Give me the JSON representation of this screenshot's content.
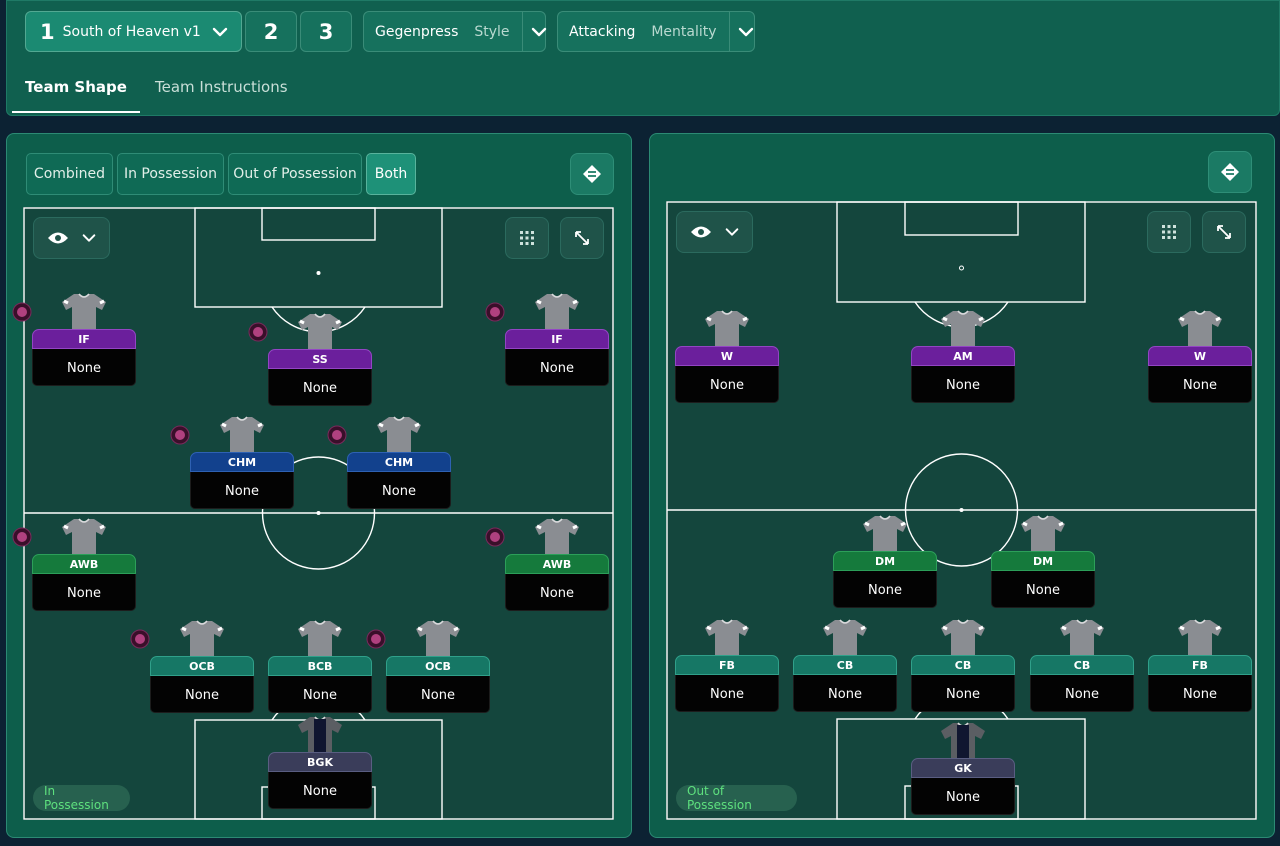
{
  "header": {
    "tactic_slots": [
      {
        "num": "1",
        "name": "South of Heaven v1"
      },
      {
        "num": "2"
      },
      {
        "num": "3"
      }
    ],
    "style": {
      "value": "Gegenpress",
      "label": "Style"
    },
    "mentality": {
      "value": "Attacking",
      "label": "Mentality"
    },
    "tabs": [
      "Team Shape",
      "Team Instructions"
    ]
  },
  "left_panel": {
    "view_tabs": [
      "Combined",
      "In Possession",
      "Out of Possession",
      "Both"
    ],
    "selected_view": "Both",
    "phase_label": "In Possession",
    "players": [
      {
        "role": "IF",
        "duty": "None",
        "color": "purple",
        "marked": true
      },
      {
        "role": "SS",
        "duty": "None",
        "color": "purple",
        "marked": true
      },
      {
        "role": "IF",
        "duty": "None",
        "color": "purple",
        "marked": true
      },
      {
        "role": "CHM",
        "duty": "None",
        "color": "blue",
        "marked": true
      },
      {
        "role": "CHM",
        "duty": "None",
        "color": "blue",
        "marked": true
      },
      {
        "role": "AWB",
        "duty": "None",
        "color": "green",
        "marked": true
      },
      {
        "role": "AWB",
        "duty": "None",
        "color": "green",
        "marked": true
      },
      {
        "role": "OCB",
        "duty": "None",
        "color": "teal",
        "marked": true
      },
      {
        "role": "BCB",
        "duty": "None",
        "color": "teal",
        "marked": false
      },
      {
        "role": "OCB",
        "duty": "None",
        "color": "teal",
        "marked": true
      },
      {
        "role": "BGK",
        "duty": "None",
        "color": "slate",
        "marked": false,
        "goalkeeper": true
      }
    ]
  },
  "right_panel": {
    "phase_label": "Out of Possession",
    "players": [
      {
        "role": "W",
        "duty": "None",
        "color": "purple"
      },
      {
        "role": "AM",
        "duty": "None",
        "color": "purple"
      },
      {
        "role": "W",
        "duty": "None",
        "color": "purple"
      },
      {
        "role": "DM",
        "duty": "None",
        "color": "green"
      },
      {
        "role": "DM",
        "duty": "None",
        "color": "green"
      },
      {
        "role": "FB",
        "duty": "None",
        "color": "teal"
      },
      {
        "role": "CB",
        "duty": "None",
        "color": "teal"
      },
      {
        "role": "CB",
        "duty": "None",
        "color": "teal"
      },
      {
        "role": "CB",
        "duty": "None",
        "color": "teal"
      },
      {
        "role": "FB",
        "duty": "None",
        "color": "teal"
      },
      {
        "role": "GK",
        "duty": "None",
        "color": "slate",
        "goalkeeper": true
      }
    ]
  },
  "icons": {
    "chevron": "chevron-down-icon",
    "eye": "eye-icon",
    "grid": "grid-view-icon",
    "expand": "expand-icon",
    "swap": "swap-icon",
    "shirt": "shirt-icon",
    "mark": "player-mark-icon"
  },
  "colors": {
    "purple": "#6b1f9c",
    "blue": "#12418d",
    "green": "#157a3c",
    "teal": "#167765",
    "slate": "#3a3d5a",
    "pitch": "#14463d",
    "accent": "#1e9178"
  }
}
